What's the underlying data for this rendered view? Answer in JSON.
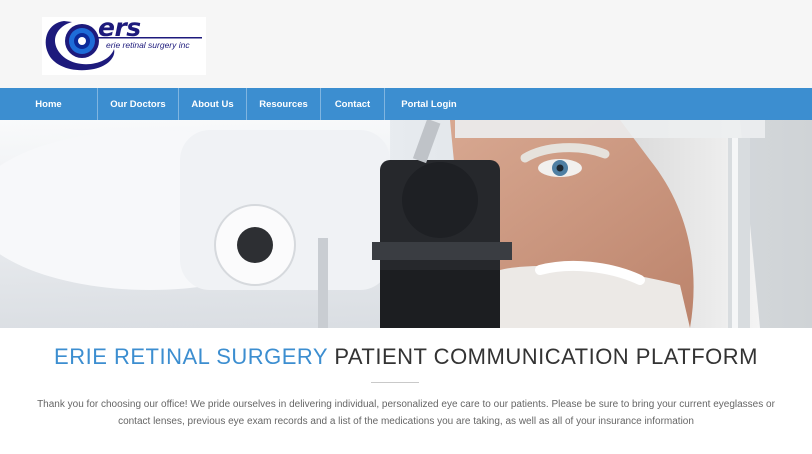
{
  "logo": {
    "abbr": "ers",
    "name": "erie retinal surgery inc",
    "colors": {
      "navy": "#1d1a7c",
      "blue": "#1e6cd8"
    }
  },
  "nav": {
    "items": [
      {
        "label": "Home"
      },
      {
        "label": "Our Doctors"
      },
      {
        "label": "About Us"
      },
      {
        "label": "Resources"
      },
      {
        "label": "Contact"
      },
      {
        "label": "Portal Login"
      }
    ],
    "background": "#3c8ed0"
  },
  "hero": {
    "subject": "older man at slit-lamp eye examination"
  },
  "page_title": {
    "accent": "ERIE RETINAL SURGERY",
    "rest": "PATIENT COMMUNICATION PLATFORM",
    "accent_color": "#3c8ed0"
  },
  "intro": {
    "text": "Thank you for choosing our office! We pride ourselves in delivering individual, personalized eye care to our patients. Please be sure to bring your current eyeglasses or contact lenses, previous eye exam records and a list of the medications you are taking, as well as all of your insurance information"
  }
}
